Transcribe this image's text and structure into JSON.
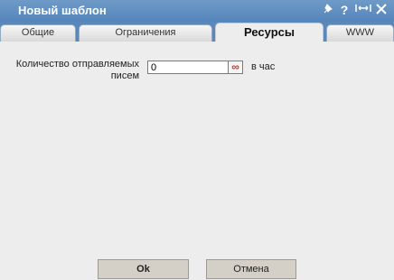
{
  "window": {
    "title": "Новый шаблон",
    "icons": {
      "pin": "pin-icon",
      "help": "?",
      "maximize": "maximize-icon",
      "close": "close-icon"
    }
  },
  "tabs": [
    {
      "label": "Общие",
      "active": false
    },
    {
      "label": "Ограничения",
      "active": false
    },
    {
      "label": "Ресурсы",
      "active": true
    },
    {
      "label": "WWW",
      "active": false
    }
  ],
  "form": {
    "messages_label": "Количество отправляемых писем",
    "messages_value": "0",
    "infinity_symbol": "∞",
    "unit": "в час"
  },
  "buttons": {
    "ok": "Ok",
    "cancel": "Отмена"
  },
  "colors": {
    "titlebar": "#5485bb",
    "accent_infinity": "#c0392b"
  }
}
